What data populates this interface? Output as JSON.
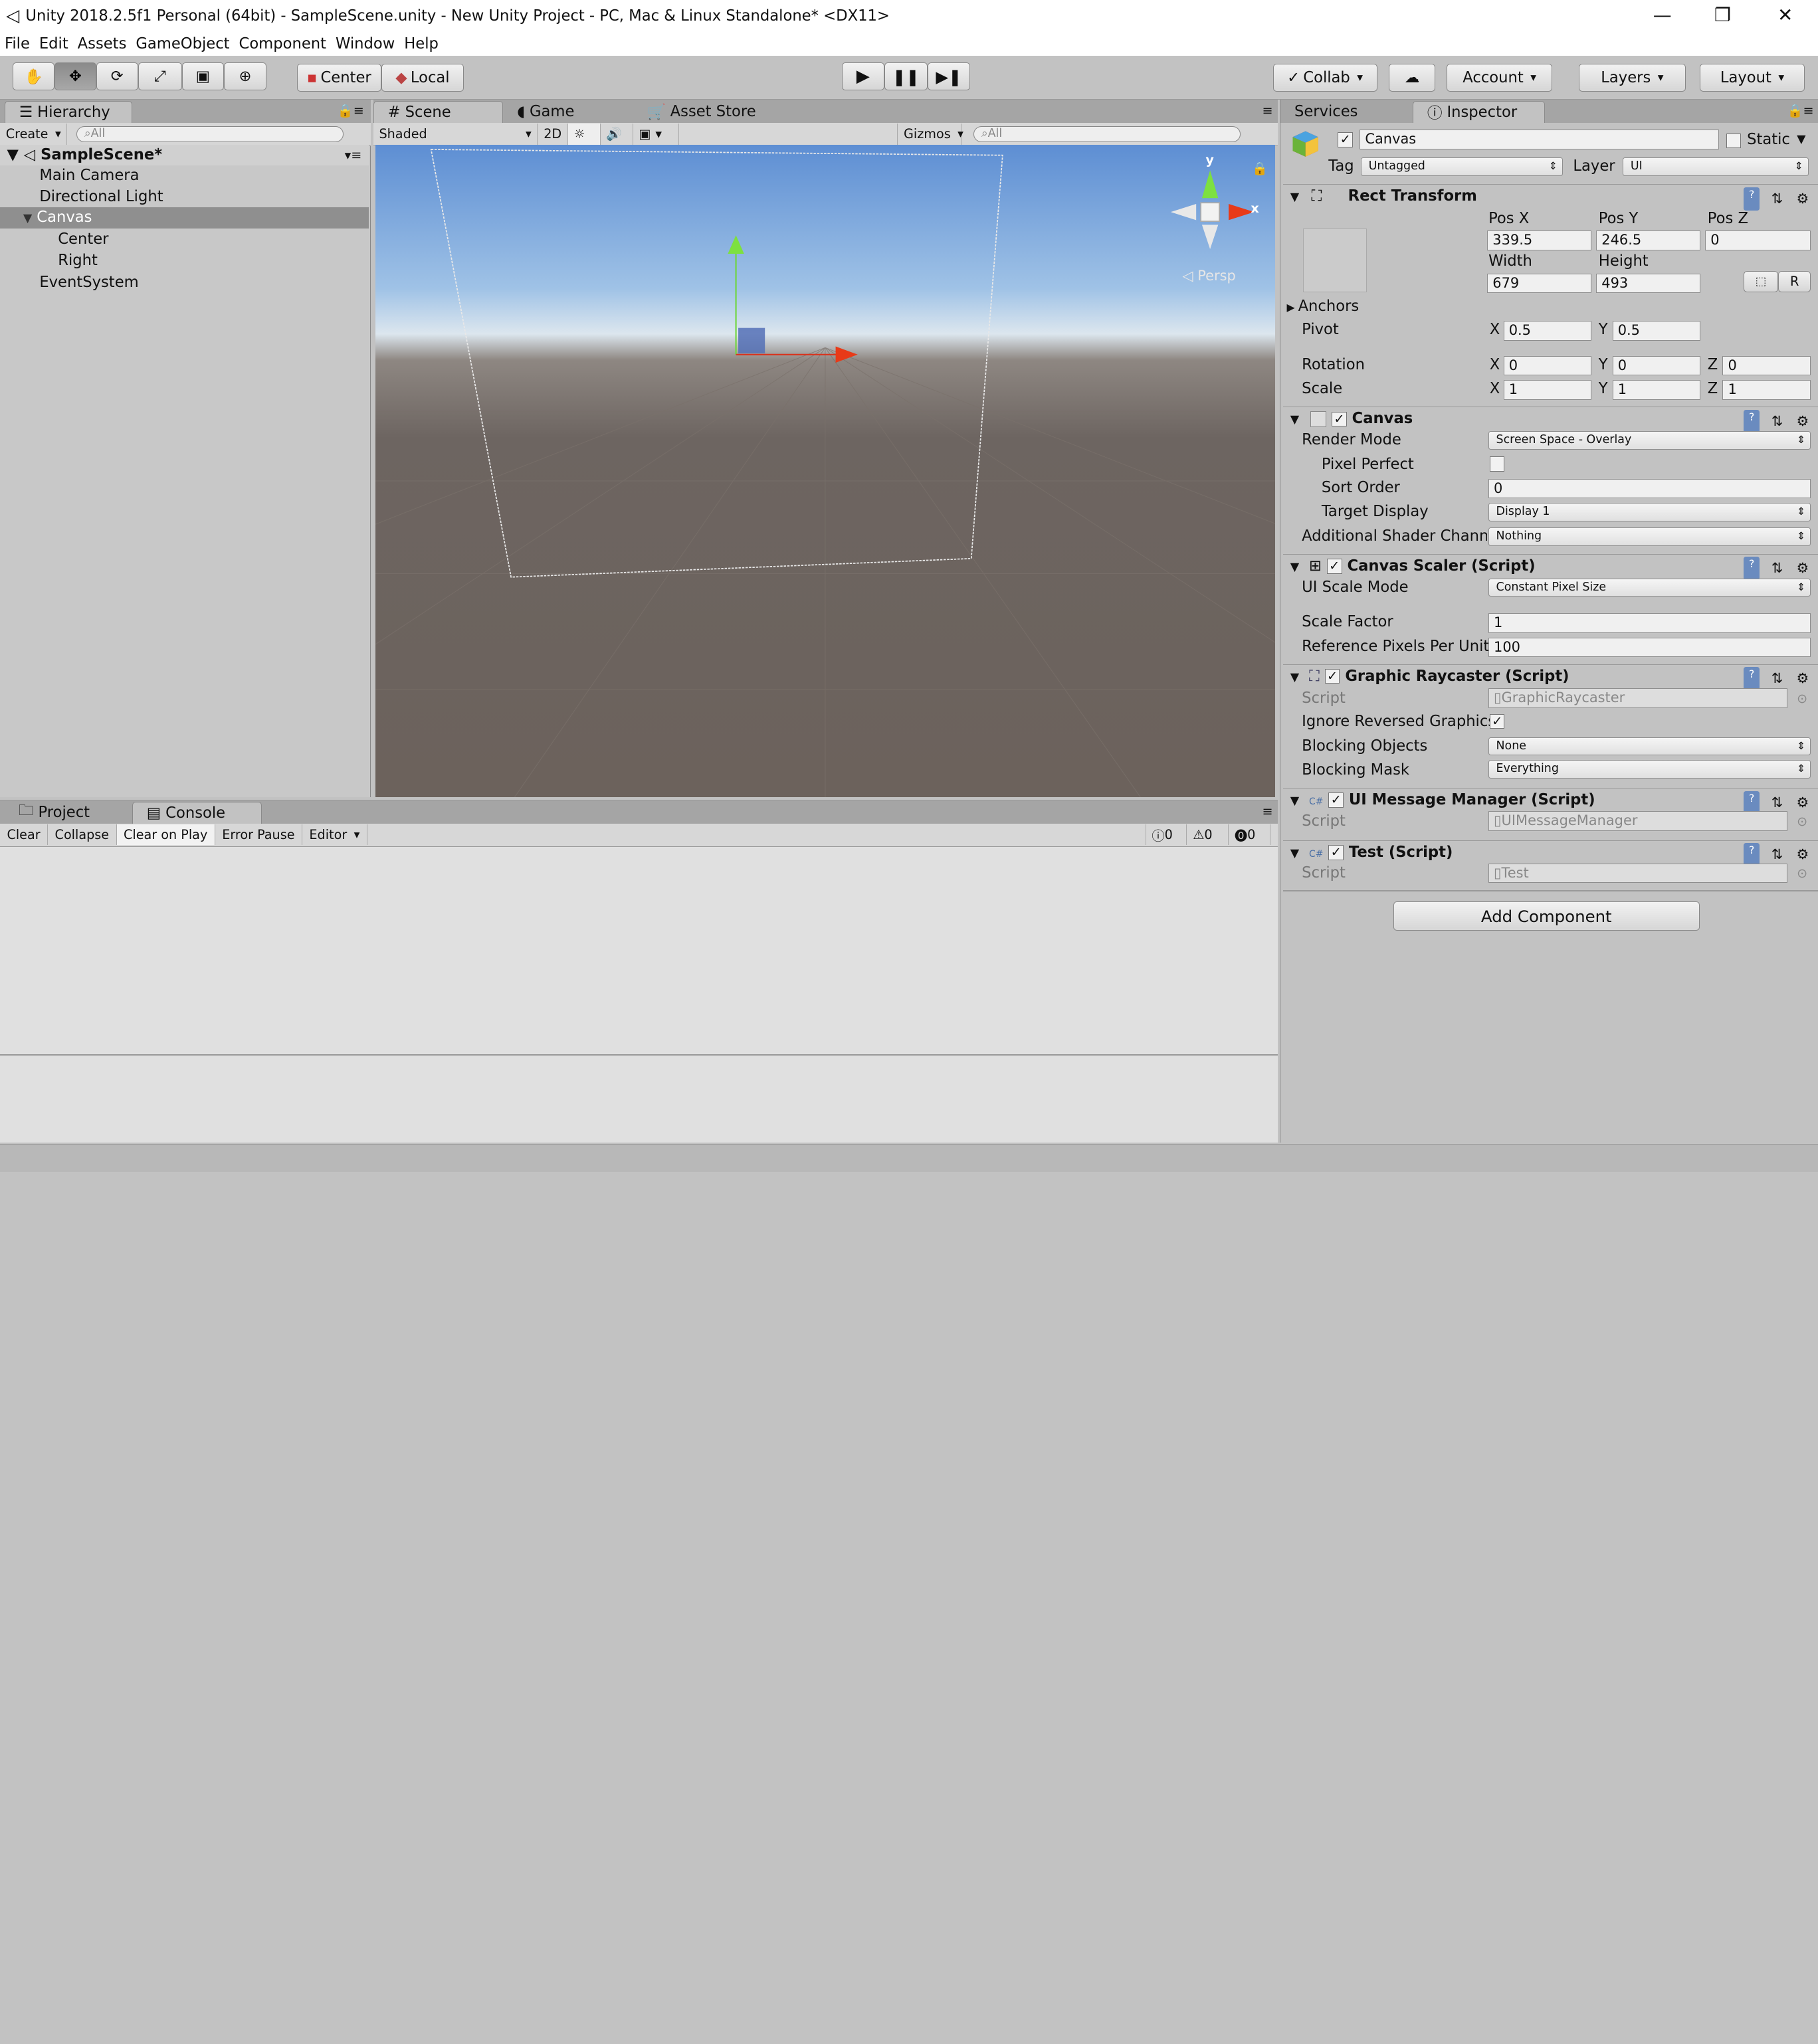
{
  "window": {
    "title": "Unity 2018.2.5f1 Personal (64bit) - SampleScene.unity - New Unity Project - PC, Mac & Linux Standalone* <DX11>",
    "controls": {
      "minimize": "—",
      "maximize": "❐",
      "close": "✕"
    }
  },
  "menu": [
    "File",
    "Edit",
    "Assets",
    "GameObject",
    "Component",
    "Window",
    "Help"
  ],
  "toolbar": {
    "tools": [
      "hand-tool",
      "move-tool",
      "rotate-tool",
      "scale-tool",
      "rect-tool",
      "transform-tool"
    ],
    "pivot_center": "Center",
    "pivot_local": "Local",
    "collab": "Collab",
    "account": "Account",
    "layers": "Layers",
    "layout": "Layout"
  },
  "hierarchy": {
    "tab": "Hierarchy",
    "create": "Create",
    "search_placeholder": "All",
    "scene": "SampleScene*",
    "items": [
      {
        "label": "Main Camera"
      },
      {
        "label": "Directional Light"
      },
      {
        "label": "Canvas"
      },
      {
        "label": "Center"
      },
      {
        "label": "Right"
      },
      {
        "label": "EventSystem"
      }
    ]
  },
  "scene": {
    "tabs": [
      "Scene",
      "Game",
      "Asset Store"
    ],
    "shaded": "Shaded",
    "mode_2d": "2D",
    "gizmos": "Gizmos",
    "search_placeholder": "All",
    "gizmo_y": "y",
    "gizmo_x": "x",
    "persp": "Persp"
  },
  "bottom": {
    "tabs": [
      "Project",
      "Console"
    ],
    "buttons": [
      "Clear",
      "Collapse",
      "Clear on Play",
      "Error Pause",
      "Editor"
    ],
    "counts": {
      "info": "0",
      "warn": "0",
      "error": "0"
    }
  },
  "inspector": {
    "tabs": [
      "Services",
      "Inspector"
    ],
    "object_name": "Canvas",
    "static_label": "Static",
    "tag_label": "Tag",
    "tag_value": "Untagged",
    "layer_label": "Layer",
    "layer_value": "UI",
    "rect": {
      "title": "Rect Transform",
      "posx_label": "Pos X",
      "posy_label": "Pos Y",
      "posz_label": "Pos Z",
      "posx": "339.5",
      "posy": "246.5",
      "posz": "0",
      "width_label": "Width",
      "height_label": "Height",
      "width": "679",
      "height": "493",
      "r_button": "R",
      "anchors": "Anchors",
      "pivot": "Pivot",
      "pivot_x": "0.5",
      "pivot_y": "0.5",
      "rotation": "Rotation",
      "rot_x": "0",
      "rot_y": "0",
      "rot_z": "0",
      "scale": "Scale",
      "scale_x": "1",
      "scale_y": "1",
      "scale_z": "1",
      "x": "X",
      "y": "Y",
      "z": "Z"
    },
    "canvas": {
      "title": "Canvas",
      "render_mode_label": "Render Mode",
      "render_mode": "Screen Space - Overlay",
      "pixel_perfect_label": "Pixel Perfect",
      "sort_order_label": "Sort Order",
      "sort_order": "0",
      "target_display_label": "Target Display",
      "target_display": "Display 1",
      "shader_label": "Additional Shader Chann",
      "shader_value": "Nothing"
    },
    "scaler": {
      "title": "Canvas Scaler (Script)",
      "mode_label": "UI Scale Mode",
      "mode": "Constant Pixel Size",
      "factor_label": "Scale Factor",
      "factor": "1",
      "ref_label": "Reference Pixels Per Unit",
      "ref": "100"
    },
    "raycaster": {
      "title": "Graphic Raycaster (Script)",
      "script_label": "Script",
      "script": "GraphicRaycaster",
      "ignore_label": "Ignore Reversed Graphics",
      "blocking_objects_label": "Blocking Objects",
      "blocking_objects": "None",
      "blocking_mask_label": "Blocking Mask",
      "blocking_mask": "Everything"
    },
    "ui_message": {
      "title": "UI Message Manager (Script)",
      "script_label": "Script",
      "script": "UIMessageManager"
    },
    "test": {
      "title": "Test (Script)",
      "script_label": "Script",
      "script": "Test"
    },
    "add_component": "Add Component"
  }
}
